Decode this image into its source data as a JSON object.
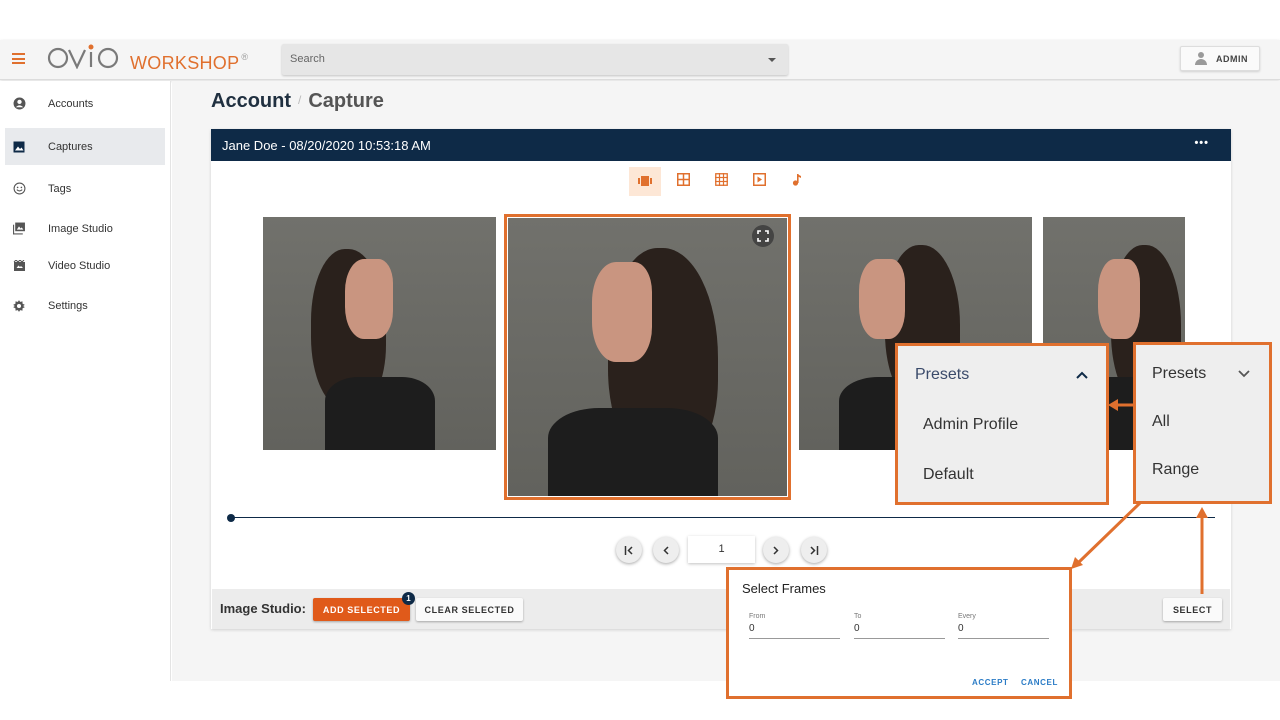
{
  "app": {
    "logo_mark": "OVIO",
    "logo_text": "WORKSHOP",
    "logo_reg": "®"
  },
  "header": {
    "search_placeholder": "Search",
    "user_label": "ADMIN"
  },
  "sidebar": {
    "items": [
      {
        "label": "Accounts",
        "icon": "account-circle-icon"
      },
      {
        "label": "Captures",
        "icon": "image-icon"
      },
      {
        "label": "Tags",
        "icon": "smiley-icon"
      },
      {
        "label": "Image Studio",
        "icon": "photo-library-icon"
      },
      {
        "label": "Video Studio",
        "icon": "movie-icon"
      },
      {
        "label": "Settings",
        "icon": "gear-icon"
      }
    ],
    "active": "Captures"
  },
  "breadcrumb": {
    "root": "Account",
    "separator": "/",
    "current": "Capture"
  },
  "capture": {
    "title": "Jane Doe - 08/20/2020 10:53:18 AM",
    "more_label": "•••",
    "view_modes": [
      "carousel-icon",
      "grid-2x2-icon",
      "grid-3x3-icon",
      "play-icon",
      "music-note-icon"
    ],
    "active_view": "carousel-icon"
  },
  "pager": {
    "first": "|<",
    "prev": "<",
    "page_value": "1",
    "next": ">",
    "last": ">|"
  },
  "footer": {
    "studio_label": "Image Studio:",
    "add_selected": "ADD SELECTED",
    "badge_count": "1",
    "clear_selected": "CLEAR SELECTED",
    "select": "SELECT"
  },
  "presets_open": {
    "header": "Presets",
    "options": [
      "Admin Profile",
      "Default"
    ]
  },
  "presets_closed": {
    "header": "Presets",
    "options": [
      "All",
      "Range"
    ]
  },
  "select_frames": {
    "title": "Select Frames",
    "from_label": "From",
    "from_value": "0",
    "to_label": "To",
    "to_value": "0",
    "every_label": "Every",
    "every_value": "0",
    "accept": "ACCEPT",
    "cancel": "CANCEL"
  },
  "colors": {
    "accent": "#e0702e",
    "navy": "#0e2a47",
    "link": "#2b7cc6"
  }
}
